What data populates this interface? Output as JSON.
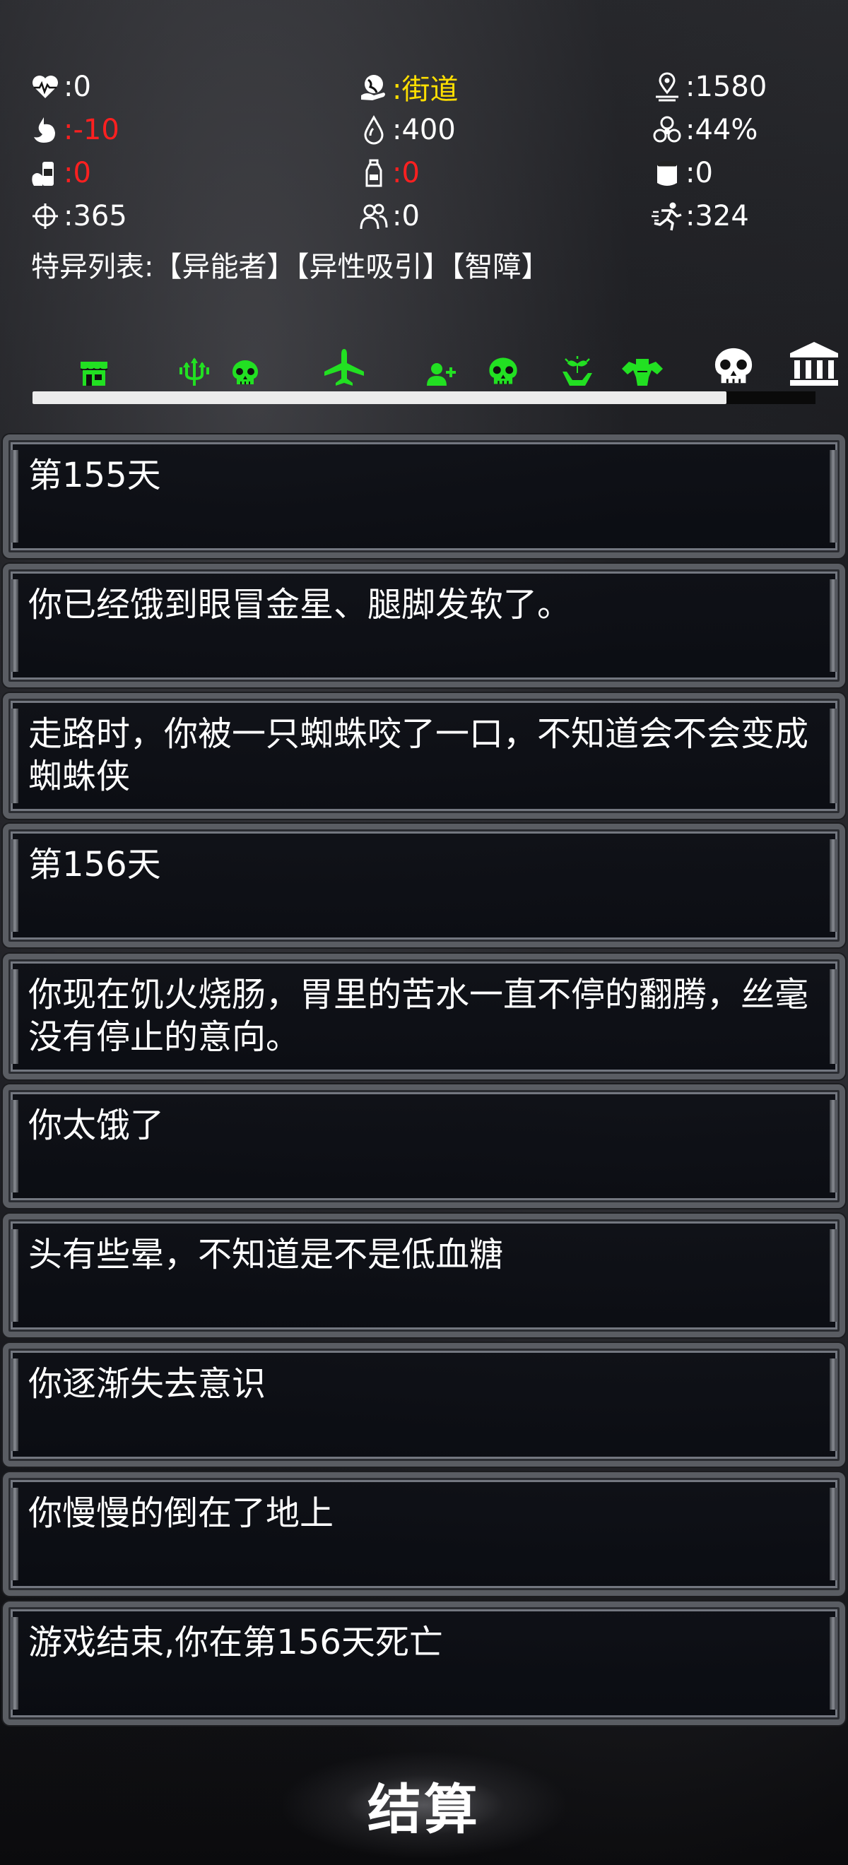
{
  "stats": {
    "health": {
      "icon": "heartbeat-icon",
      "value": ":0"
    },
    "location": {
      "icon": "globe-hand-icon",
      "value": ":街道"
    },
    "distance": {
      "icon": "location-pin-icon",
      "value": ":1580"
    },
    "hunger": {
      "icon": "stomach-icon",
      "value": ":-10"
    },
    "water": {
      "icon": "water-drop-icon",
      "value": ":400"
    },
    "infection": {
      "icon": "biohazard-icon",
      "value": ":44%"
    },
    "food": {
      "icon": "food-can-icon",
      "value": ":0"
    },
    "drink": {
      "icon": "bottle-icon",
      "value": ":0"
    },
    "ammo": {
      "icon": "canister-icon",
      "value": ":0"
    },
    "crosshair": {
      "icon": "crosshair-icon",
      "value": ":365"
    },
    "companions": {
      "icon": "people-icon",
      "value": ":0"
    },
    "stamina": {
      "icon": "running-icon",
      "value": ":324"
    },
    "traits": "特异列表:【异能者】【异性吸引】【智障】"
  },
  "timeline": {
    "progress": 0.886,
    "events": [
      {
        "icon": "shop-icon",
        "color": "#22e022"
      },
      {
        "icon": "trident-icon",
        "color": "#22e022"
      },
      {
        "icon": "skull-icon",
        "color": "#22e022"
      },
      {
        "icon": "airplane-icon",
        "color": "#22e022"
      },
      {
        "icon": "add-person-icon",
        "color": "#22e022"
      },
      {
        "icon": "skull-icon",
        "color": "#22e022"
      },
      {
        "icon": "sprout-hand-icon",
        "color": "#22e022"
      },
      {
        "icon": "muscle-icon",
        "color": "#22e022"
      },
      {
        "icon": "skull-icon",
        "color": "#ffffff"
      },
      {
        "icon": "bank-icon",
        "color": "#ffffff"
      }
    ]
  },
  "log": [
    "第155天",
    "你已经饿到眼冒金星、腿脚发软了。",
    "走路时，你被一只蜘蛛咬了一口，不知道会不会变成蜘蛛侠",
    "第156天",
    "你现在饥火烧肠，胃里的苦水一直不停的翻腾，丝毫没有停止的意向。",
    "你太饿了",
    "头有些晕，不知道是不是低血糖",
    "你逐渐失去意识",
    "你慢慢的倒在了地上",
    "游戏结束,你在第156天死亡"
  ],
  "settle_label": "结算",
  "colors": {
    "red": "#ff2020",
    "yellow": "#ffdf00",
    "green": "#22e022"
  }
}
